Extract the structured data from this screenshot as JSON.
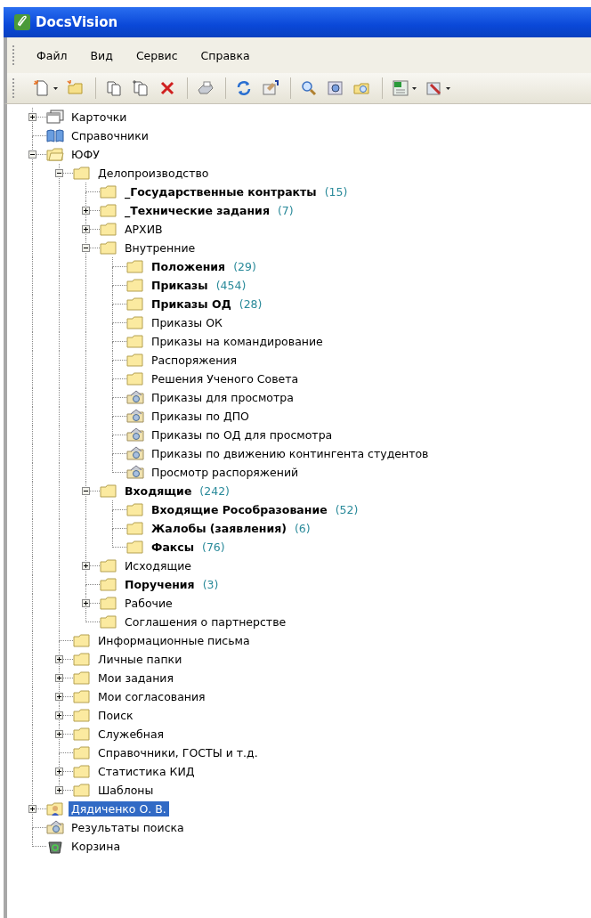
{
  "window": {
    "title": "DocsVision"
  },
  "menu": [
    {
      "label": "Файл"
    },
    {
      "label": "Вид"
    },
    {
      "label": "Сервис"
    },
    {
      "label": "Справка"
    }
  ],
  "toolbar": [
    {
      "kind": "new-document",
      "dropdown": true
    },
    {
      "kind": "new-folder",
      "dropdown": false
    },
    {
      "kind": "separator"
    },
    {
      "kind": "copy",
      "dropdown": false
    },
    {
      "kind": "copy-add",
      "dropdown": false
    },
    {
      "kind": "delete",
      "dropdown": false
    },
    {
      "kind": "separator"
    },
    {
      "kind": "print",
      "dropdown": false
    },
    {
      "kind": "separator"
    },
    {
      "kind": "refresh",
      "dropdown": false
    },
    {
      "kind": "properties",
      "dropdown": false
    },
    {
      "kind": "separator"
    },
    {
      "kind": "search",
      "dropdown": false
    },
    {
      "kind": "view",
      "dropdown": false
    },
    {
      "kind": "search-folder",
      "dropdown": false
    },
    {
      "kind": "separator"
    },
    {
      "kind": "export",
      "dropdown": true
    },
    {
      "kind": "tools",
      "dropdown": true
    }
  ],
  "tree": [
    {
      "label": "Карточки",
      "kind": "cards",
      "expanded": false,
      "selected": false,
      "unread": false
    },
    {
      "label": "Справочники",
      "kind": "book",
      "selected": false,
      "unread": false
    },
    {
      "label": "ЮФУ",
      "kind": "open-folder",
      "expanded": true,
      "selected": false,
      "unread": false,
      "children": [
        {
          "label": "Делопроизводство",
          "kind": "folder",
          "expanded": true,
          "selected": false,
          "unread": false,
          "children": [
            {
              "label": "_Государственные контракты",
              "count": "(15)",
              "kind": "folder",
              "selected": false,
              "unread": true
            },
            {
              "label": "_Технические задания",
              "count": "(7)",
              "kind": "folder",
              "expanded": false,
              "selected": false,
              "unread": true
            },
            {
              "label": "АРХИВ",
              "kind": "folder",
              "expanded": false,
              "selected": false,
              "unread": false
            },
            {
              "label": "Внутренние",
              "kind": "folder",
              "expanded": true,
              "selected": false,
              "unread": false,
              "children": [
                {
                  "label": "Положения",
                  "count": "(29)",
                  "kind": "folder",
                  "selected": false,
                  "unread": true
                },
                {
                  "label": "Приказы",
                  "count": "(454)",
                  "kind": "folder",
                  "selected": false,
                  "unread": true
                },
                {
                  "label": "Приказы ОД",
                  "count": "(28)",
                  "kind": "folder",
                  "selected": false,
                  "unread": true
                },
                {
                  "label": "Приказы ОК",
                  "kind": "folder",
                  "selected": false,
                  "unread": false
                },
                {
                  "label": "Приказы на командирование",
                  "kind": "folder",
                  "selected": false,
                  "unread": false
                },
                {
                  "label": "Распоряжения",
                  "kind": "folder",
                  "selected": false,
                  "unread": false
                },
                {
                  "label": "Решения Ученого Совета",
                  "kind": "folder",
                  "selected": false,
                  "unread": false
                },
                {
                  "label": "Приказы для просмотра",
                  "kind": "search-folder",
                  "selected": false,
                  "unread": false
                },
                {
                  "label": "Приказы по ДПО",
                  "kind": "search-folder",
                  "selected": false,
                  "unread": false
                },
                {
                  "label": "Приказы по ОД для просмотра",
                  "kind": "search-folder",
                  "selected": false,
                  "unread": false
                },
                {
                  "label": "Приказы по движению контингента студентов",
                  "kind": "search-folder",
                  "selected": false,
                  "unread": false
                },
                {
                  "label": "Просмотр распоряжений",
                  "kind": "search-folder",
                  "selected": false,
                  "unread": false
                }
              ]
            },
            {
              "label": "Входящие",
              "count": "(242)",
              "kind": "folder",
              "expanded": true,
              "selected": false,
              "unread": true,
              "children": [
                {
                  "label": "Входящие Рособразование",
                  "count": "(52)",
                  "kind": "folder",
                  "selected": false,
                  "unread": true
                },
                {
                  "label": "Жалобы (заявления)",
                  "count": "(6)",
                  "kind": "folder",
                  "selected": false,
                  "unread": true
                },
                {
                  "label": "Факсы",
                  "count": "(76)",
                  "kind": "folder",
                  "selected": false,
                  "unread": true
                }
              ]
            },
            {
              "label": "Исходящие",
              "kind": "folder",
              "expanded": false,
              "selected": false,
              "unread": false
            },
            {
              "label": "Поручения",
              "count": "(3)",
              "kind": "folder",
              "selected": false,
              "unread": true
            },
            {
              "label": "Рабочие",
              "kind": "folder",
              "expanded": false,
              "selected": false,
              "unread": false
            },
            {
              "label": "Соглашения о партнерстве",
              "kind": "folder",
              "selected": false,
              "unread": false
            }
          ]
        },
        {
          "label": "Информационные письма",
          "kind": "folder",
          "selected": false,
          "unread": false
        },
        {
          "label": "Личные папки",
          "kind": "folder",
          "expanded": false,
          "selected": false,
          "unread": false
        },
        {
          "label": "Мои задания",
          "kind": "folder",
          "expanded": false,
          "selected": false,
          "unread": false
        },
        {
          "label": "Мои согласования",
          "kind": "folder",
          "expanded": false,
          "selected": false,
          "unread": false
        },
        {
          "label": "Поиск",
          "kind": "folder",
          "expanded": false,
          "selected": false,
          "unread": false
        },
        {
          "label": "Служебная",
          "kind": "folder",
          "expanded": false,
          "selected": false,
          "unread": false
        },
        {
          "label": "Справочники, ГОСТЫ и т.д.",
          "kind": "folder",
          "selected": false,
          "unread": false
        },
        {
          "label": "Статистика КИД",
          "kind": "folder",
          "expanded": false,
          "selected": false,
          "unread": false
        },
        {
          "label": "Шаблоны",
          "kind": "folder",
          "expanded": false,
          "selected": false,
          "unread": false
        }
      ]
    },
    {
      "label": "Дядиченко О. В.",
      "kind": "user-folder",
      "expanded": false,
      "selected": true,
      "unread": false
    },
    {
      "label": "Результаты поиска",
      "kind": "search-folder",
      "selected": false,
      "unread": false
    },
    {
      "label": "Корзина",
      "kind": "trash",
      "selected": false,
      "unread": false
    }
  ]
}
